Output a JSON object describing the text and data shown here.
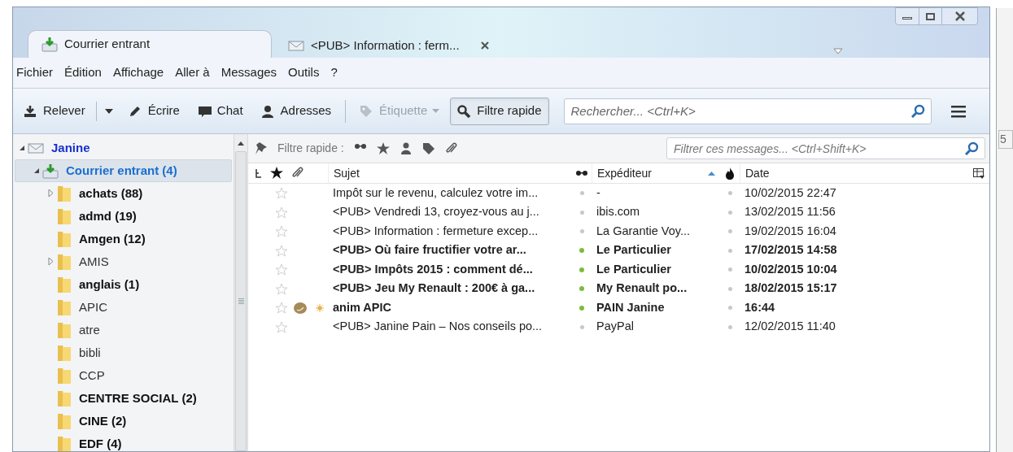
{
  "tabs": [
    {
      "label": "Courrier entrant",
      "kind": "folder",
      "selected": true
    },
    {
      "label": "<PUB> Information : ferm...",
      "kind": "message",
      "selected": false
    }
  ],
  "menu": [
    "Fichier",
    "Édition",
    "Affichage",
    "Aller à",
    "Messages",
    "Outils",
    "?"
  ],
  "toolbar": {
    "buttons": [
      {
        "label": "Relever",
        "kind": "get"
      },
      {
        "label": "Écrire",
        "kind": "write"
      },
      {
        "label": "Chat",
        "kind": "chat"
      },
      {
        "label": "Adresses",
        "kind": "contacts"
      },
      {
        "label": "Étiquette",
        "kind": "tag",
        "disabled": true
      },
      {
        "label": "Filtre rapide",
        "kind": "filter",
        "pressed": true
      }
    ],
    "search": {
      "placeholder": "Rechercher... <Ctrl+K>"
    }
  },
  "folders": [
    {
      "name": "Janine",
      "kind": "account",
      "expanded": true,
      "children": [
        {
          "name": "Courrier entrant (4)",
          "kind": "inbox",
          "expanded": true,
          "selected": true,
          "children": [
            {
              "name": "achats (88)",
              "unread": true,
              "expanded": false
            },
            {
              "name": "admd (19)",
              "unread": true
            },
            {
              "name": "Amgen (12)",
              "unread": true
            },
            {
              "name": "AMIS",
              "unread": false,
              "expanded": false
            },
            {
              "name": "anglais (1)",
              "unread": true
            },
            {
              "name": "APIC",
              "unread": false
            },
            {
              "name": "atre",
              "unread": false
            },
            {
              "name": "bibli",
              "unread": false
            },
            {
              "name": "CCP",
              "unread": false
            },
            {
              "name": "CENTRE SOCIAL (2)",
              "unread": true
            },
            {
              "name": "CINE (2)",
              "unread": true
            },
            {
              "name": "EDF (4)",
              "unread": true
            }
          ]
        }
      ]
    }
  ],
  "quick_filter": {
    "label": "Filtre rapide :",
    "placeholder": "Filtrer ces messages... <Ctrl+Shift+K>"
  },
  "columns": [
    {
      "label": "Sujet"
    },
    {
      "label": "Expéditeur",
      "sorted": true
    },
    {
      "label": "Date"
    }
  ],
  "messages": [
    {
      "subject": "Impôt sur le revenu, calculez votre im...",
      "sender": "-",
      "date": "10/02/2015 22:47",
      "unread": false,
      "attachment": false,
      "new": false
    },
    {
      "subject": "<PUB> Vendredi 13, croyez-vous au j...",
      "sender": "ibis.com",
      "date": "13/02/2015 11:56",
      "unread": false,
      "attachment": false,
      "new": false
    },
    {
      "subject": "<PUB> Information : fermeture excep...",
      "sender": "La Garantie Voy...",
      "date": "19/02/2015 16:04",
      "unread": false,
      "attachment": false,
      "new": false
    },
    {
      "subject": "<PUB> Où faire fructifier votre ar...",
      "sender": "Le Particulier",
      "date": "17/02/2015 14:58",
      "unread": true,
      "attachment": false,
      "new": false
    },
    {
      "subject": "<PUB> Impôts 2015 : comment dé...",
      "sender": "Le Particulier",
      "date": "10/02/2015 10:04",
      "unread": true,
      "attachment": false,
      "new": false
    },
    {
      "subject": "<PUB> Jeu My Renault : 200€ à ga...",
      "sender": "My Renault po...",
      "date": "18/02/2015 15:17",
      "unread": true,
      "attachment": false,
      "new": false
    },
    {
      "subject": "anim APIC",
      "sender": "PAIN Janine",
      "date": "16:44",
      "unread": true,
      "attachment": true,
      "new": true
    },
    {
      "subject": "<PUB> Janine Pain – Nos conseils po...",
      "sender": "PayPal",
      "date": "12/02/2015 11:40",
      "unread": false,
      "attachment": false,
      "new": false
    }
  ],
  "background_window": {
    "text": "5"
  }
}
